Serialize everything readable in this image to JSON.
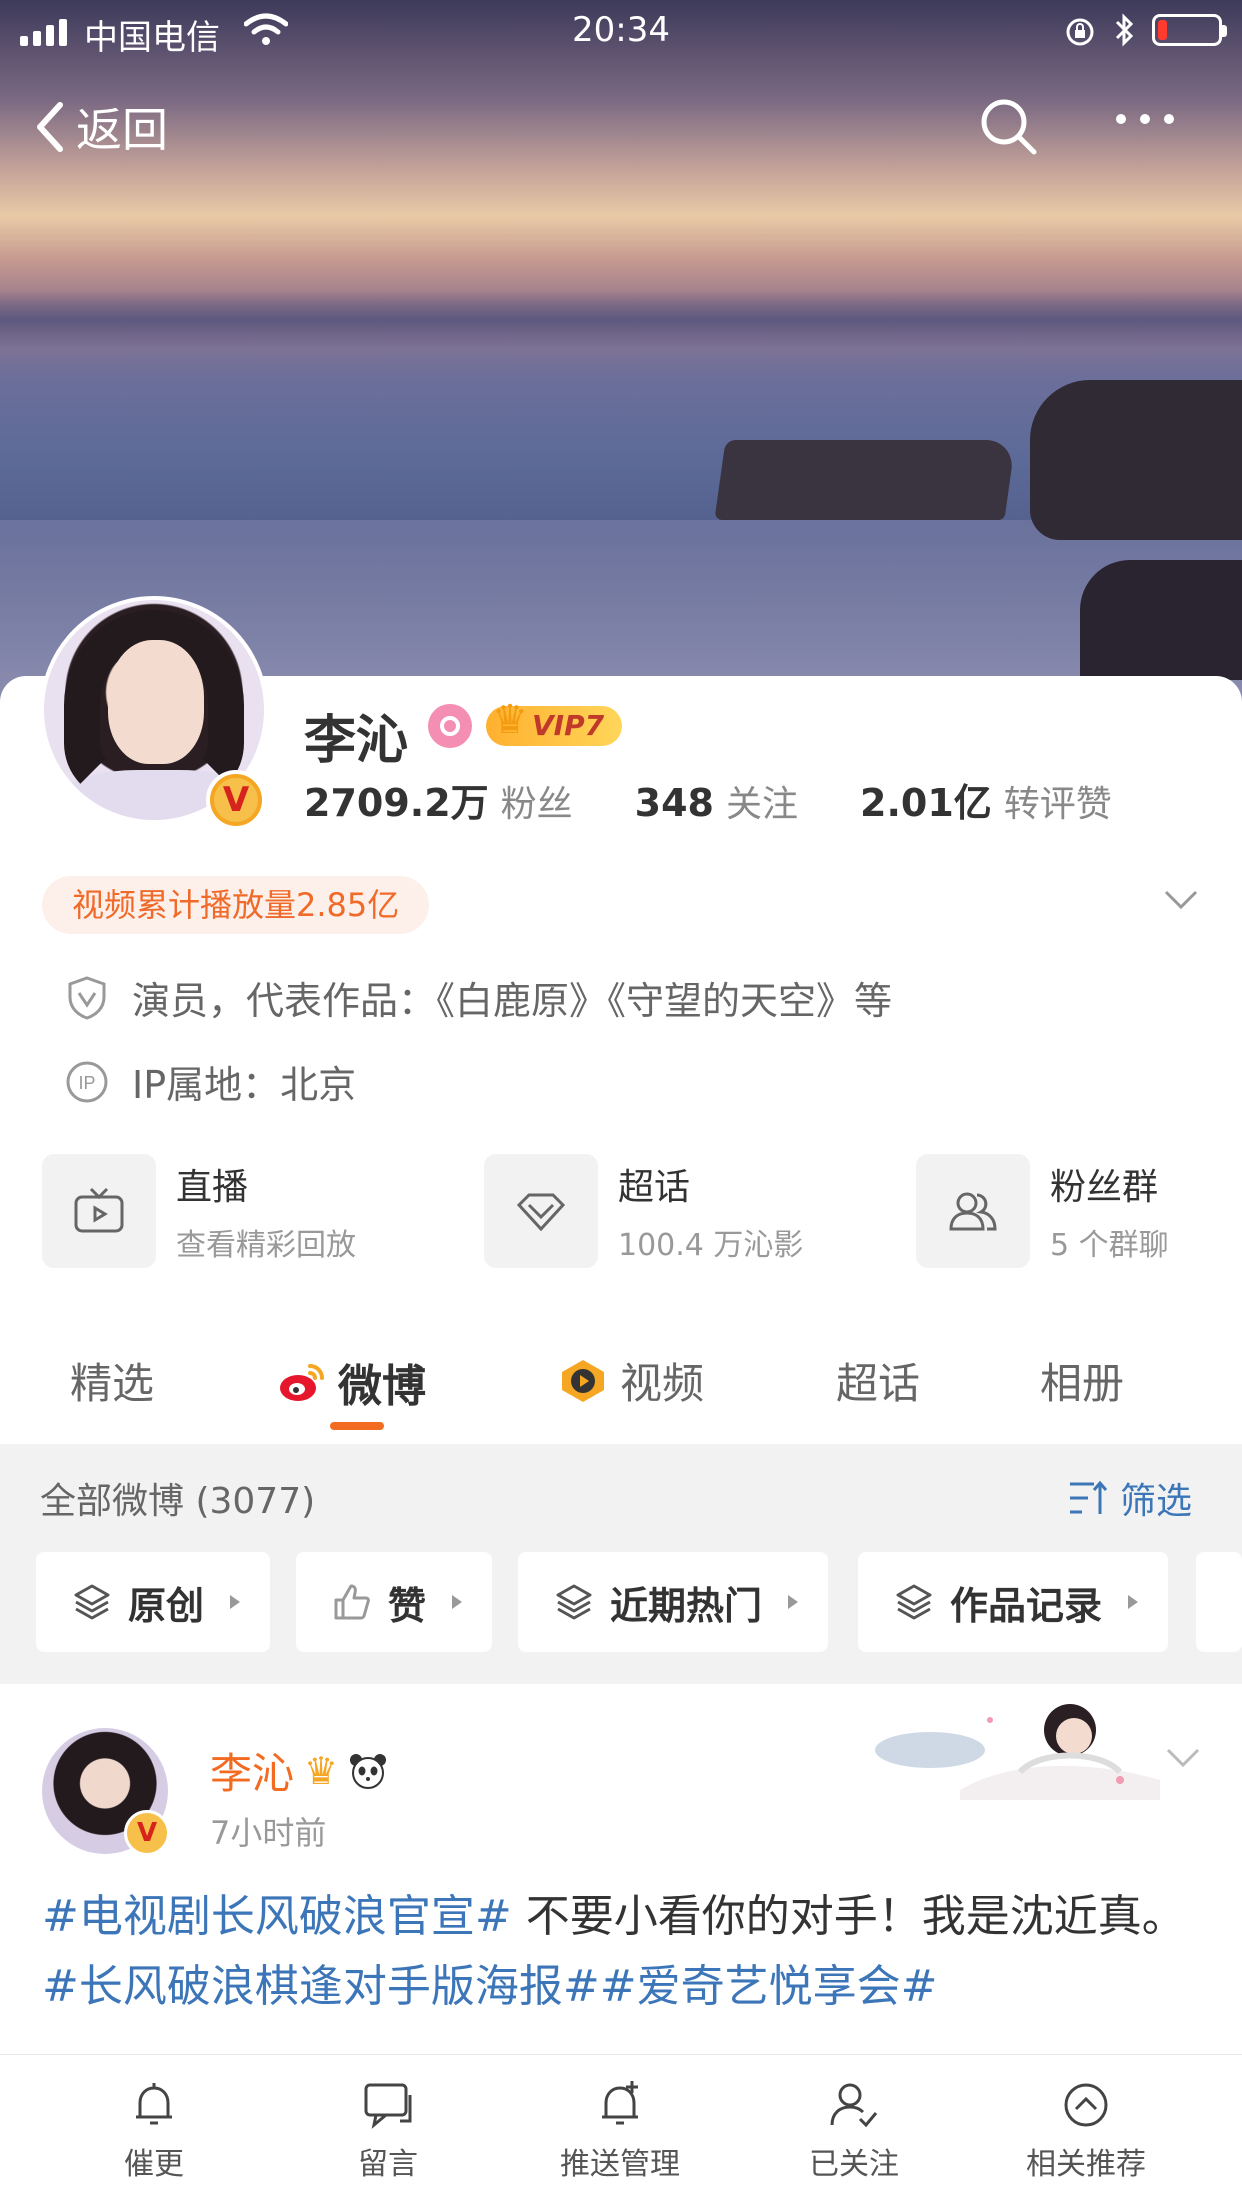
{
  "status_bar": {
    "carrier": "中国电信",
    "time": "20:34"
  },
  "nav": {
    "back_label": "返回"
  },
  "profile": {
    "name": "李沁",
    "vip_label": "VIP7",
    "stats": [
      {
        "value": "2709.2万",
        "label": "粉丝"
      },
      {
        "value": "348",
        "label": "关注"
      },
      {
        "value": "2.01亿",
        "label": "转评赞"
      }
    ],
    "play_count": "视频累计播放量2.85亿",
    "verified_info": "演员，代表作品：《白鹿原》《守望的天空》等",
    "ip_location": "IP属地：北京"
  },
  "quick_entries": [
    {
      "title": "直播",
      "subtitle": "查看精彩回放"
    },
    {
      "title": "超话",
      "subtitle": "100.4 万沁影"
    },
    {
      "title": "粉丝群",
      "subtitle": "5 个群聊"
    }
  ],
  "tabs": [
    "精选",
    "微博",
    "视频",
    "超话",
    "相册"
  ],
  "active_tab": "微博",
  "feed_header": {
    "all_count": "全部微博 (3077)",
    "filter_label": "筛选"
  },
  "filter_chips": [
    "原创",
    "赞",
    "近期热门",
    "作品记录"
  ],
  "post": {
    "author": "李沁",
    "time": "7小时前",
    "text_parts": [
      {
        "text": "#电视剧长风破浪官宣#",
        "tag": true
      },
      {
        "text": " 不要小看你的对手！我是沈近真。",
        "tag": false
      },
      {
        "text": "#长风破浪棋逢对手版海报##爱奇艺悦享会#",
        "tag": true
      }
    ]
  },
  "bottom_bar": [
    "催更",
    "留言",
    "推送管理",
    "已关注",
    "相关推荐"
  ],
  "colors": {
    "accent": "#f26b21",
    "link": "#3c76b8",
    "vip": "#ffb02e"
  }
}
